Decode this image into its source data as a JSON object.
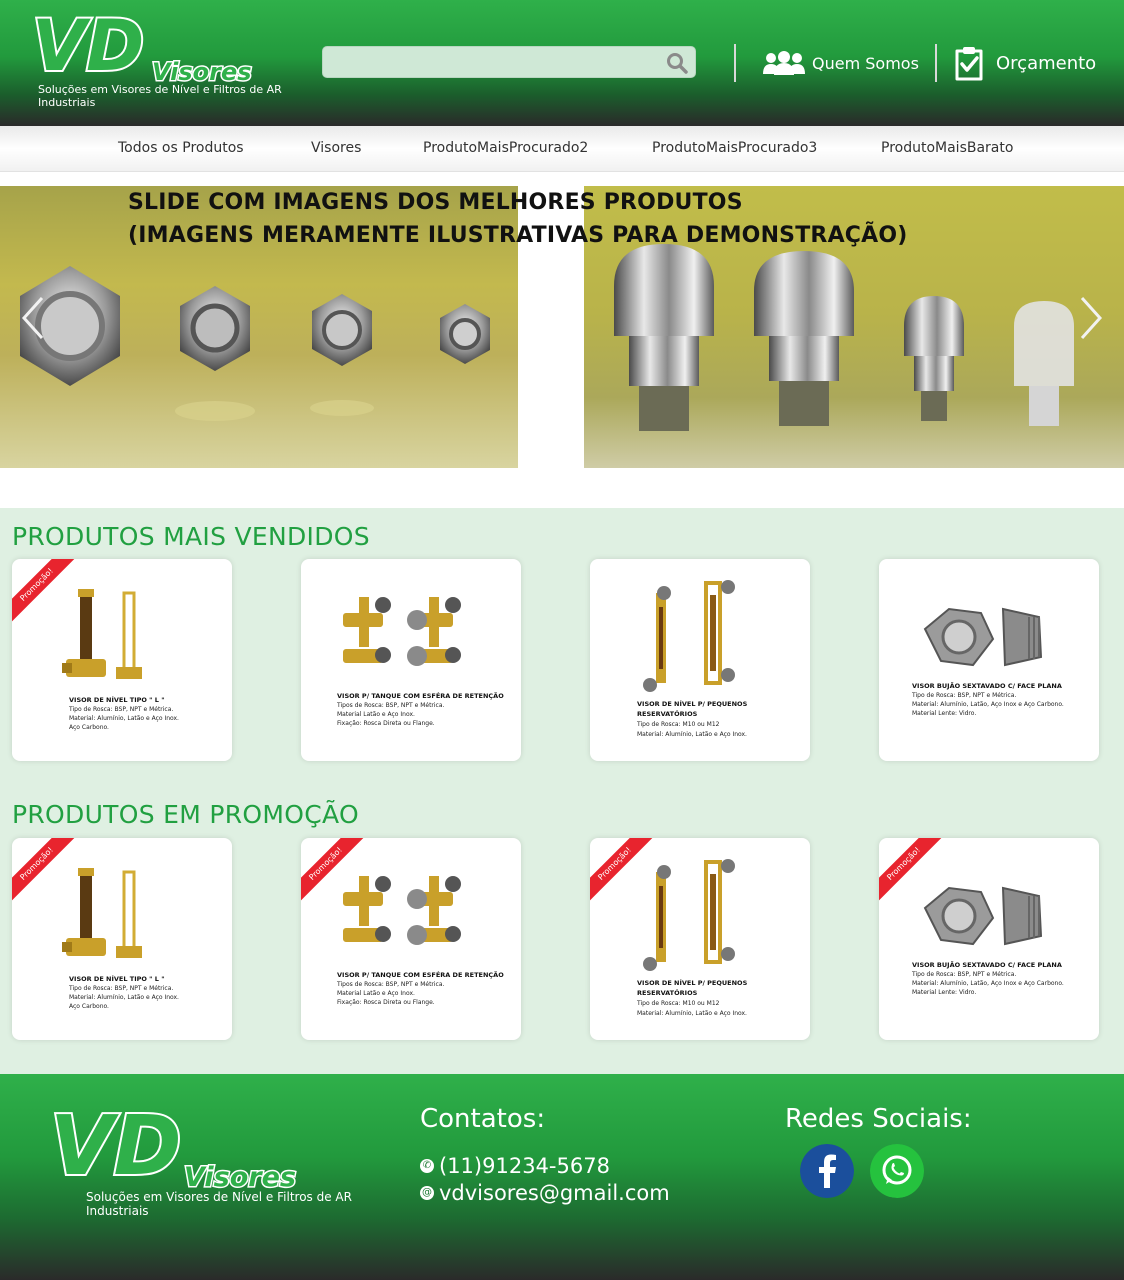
{
  "brand": {
    "logo_letters": "VD",
    "logo_word": "Visores",
    "tagline": "Soluções em Visores de Nível e Filtros de AR Industriais"
  },
  "header": {
    "search_placeholder": "",
    "quem_somos": "Quem Somos",
    "orcamento": "Orçamento"
  },
  "nav": {
    "items": [
      "Todos os Produtos",
      "Visores",
      "ProdutoMaisProcurado2",
      "ProdutoMaisProcurado3",
      "ProdutoMaisBarato"
    ]
  },
  "slider": {
    "title_line1": "SLIDE COM IMAGENS DOS MELHORES PRODUTOS",
    "title_line2": "(IMAGENS MERAMENTE ILUSTRATIVAS PARA DEMONSTRAÇÃO)"
  },
  "ribbon_label": "Promoção!",
  "sections": {
    "mais_vendidos": "PRODUTOS MAIS VENDIDOS",
    "em_promocao": "PRODUTOS EM PROMOÇÃO"
  },
  "products": [
    {
      "title": "VISOR DE NÍVEL TIPO \" L \"",
      "lines": [
        "Tipo de Rosca: BSP, NPT e Métrica.",
        "Material: Alumínio, Latão e Aço Inox.",
        "Aço Carbono."
      ]
    },
    {
      "title": "VISOR P/ TANQUE COM ESFÉRA DE RETENÇÃO",
      "lines": [
        "Tipos de Rosca: BSP, NPT e Métrica.",
        "Material Latão e Aço Inox.",
        "Fixação: Rosca Direta ou Flange."
      ]
    },
    {
      "title": "VISOR DE NÍVEL P/ PEQUENOS",
      "title2": "RESERVATÓRIOS",
      "lines": [
        "Tipo de Rosca: M10 ou M12",
        "Material: Alumínio, Latão e Aço Inox."
      ]
    },
    {
      "title": "VISOR BUJÃO SEXTAVADO C/ FACE PLANA",
      "lines": [
        "Tipo de Rosca: BSP, NPT e Métrica.",
        "Material: Alumínio, Latão, Aço Inox e Aço Carbono.",
        "Material Lente: Vidro."
      ]
    }
  ],
  "footer": {
    "contatos_heading": "Contatos:",
    "phone": "(11)91234-5678",
    "email": "vdvisores@gmail.com",
    "redes_heading": "Redes Sociais:"
  },
  "colors": {
    "brand_green": "#21a041",
    "header_dark": "#2a2a2a",
    "ribbon_red": "#e8242e",
    "products_bg": "#dff0e2",
    "facebook_blue": "#1b4f9c",
    "whatsapp_green": "#25c23e"
  },
  "icons": {
    "search": "search-icon",
    "quem_somos": "users-icon",
    "orcamento": "clipboard-check-icon",
    "slider_prev": "chevron-left-icon",
    "slider_next": "chevron-right-icon",
    "phone": "phone-icon",
    "email": "at-icon",
    "facebook": "facebook-icon",
    "whatsapp": "whatsapp-icon"
  }
}
